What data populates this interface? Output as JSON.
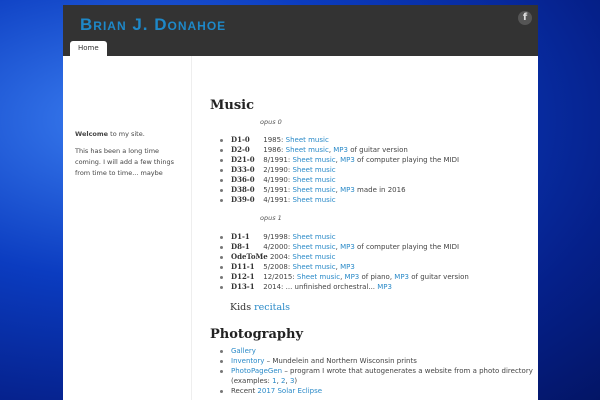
{
  "header": {
    "title": "Brian J. Donahoe",
    "facebook_icon": "facebook-icon",
    "nav": [
      {
        "label": "Home"
      }
    ]
  },
  "sidebar": {
    "welcome_bold": "Welcome",
    "welcome_rest": " to my site.",
    "note": "This has been a long time coming. I will add a few things from time to time... maybe"
  },
  "music": {
    "title": "Music",
    "opus0": {
      "label": "opus 0",
      "items": [
        {
          "code": "D1-0",
          "parts": [
            {
              "t": "1985: "
            },
            {
              "t": "Sheet music",
              "link": true
            }
          ]
        },
        {
          "code": "D2-0",
          "parts": [
            {
              "t": "1986: "
            },
            {
              "t": "Sheet music",
              "link": true
            },
            {
              "t": ", "
            },
            {
              "t": "MP3",
              "link": true
            },
            {
              "t": " of guitar version"
            }
          ]
        },
        {
          "code": "D21-0",
          "parts": [
            {
              "t": "8/1991: "
            },
            {
              "t": "Sheet music",
              "link": true
            },
            {
              "t": ", "
            },
            {
              "t": "MP3",
              "link": true
            },
            {
              "t": " of computer playing the MIDI"
            }
          ]
        },
        {
          "code": "D33-0",
          "parts": [
            {
              "t": "2/1990: "
            },
            {
              "t": "Sheet music",
              "link": true
            }
          ]
        },
        {
          "code": "D36-0",
          "parts": [
            {
              "t": "4/1990: "
            },
            {
              "t": "Sheet music",
              "link": true
            }
          ]
        },
        {
          "code": "D38-0",
          "parts": [
            {
              "t": "5/1991: "
            },
            {
              "t": "Sheet music",
              "link": true
            },
            {
              "t": ", "
            },
            {
              "t": "MP3",
              "link": true
            },
            {
              "t": " made in 2016"
            }
          ]
        },
        {
          "code": "D39-0",
          "parts": [
            {
              "t": "4/1991: "
            },
            {
              "t": "Sheet music",
              "link": true
            }
          ]
        }
      ]
    },
    "opus1": {
      "label": "opus 1",
      "items": [
        {
          "code": "D1-1",
          "parts": [
            {
              "t": "9/1998: "
            },
            {
              "t": "Sheet music",
              "link": true
            }
          ]
        },
        {
          "code": "D8-1",
          "parts": [
            {
              "t": "4/2000: "
            },
            {
              "t": "Sheet music",
              "link": true
            },
            {
              "t": ", "
            },
            {
              "t": "MP3",
              "link": true
            },
            {
              "t": " of computer playing the MIDI"
            }
          ]
        },
        {
          "code": "OdeToMe",
          "parts": [
            {
              "t": "2004: "
            },
            {
              "t": "Sheet music",
              "link": true
            }
          ]
        },
        {
          "code": "D11-1",
          "parts": [
            {
              "t": "5/2008: "
            },
            {
              "t": "Sheet music",
              "link": true
            },
            {
              "t": ", "
            },
            {
              "t": "MP3",
              "link": true
            }
          ]
        },
        {
          "code": "D12-1",
          "parts": [
            {
              "t": "12/2015: "
            },
            {
              "t": "Sheet music",
              "link": true
            },
            {
              "t": ", "
            },
            {
              "t": "MP3",
              "link": true
            },
            {
              "t": " of piano, "
            },
            {
              "t": "MP3",
              "link": true
            },
            {
              "t": " of guitar version"
            }
          ]
        },
        {
          "code": "D13-1",
          "parts": [
            {
              "t": "2014: ... unfinished orchestral...   "
            },
            {
              "t": "MP3",
              "link": true
            }
          ]
        }
      ]
    },
    "kids_label": "Kids",
    "kids_link": "recitals"
  },
  "photography": {
    "title": "Photography",
    "items": [
      {
        "parts": [
          {
            "t": "Gallery",
            "link": true
          }
        ]
      },
      {
        "parts": [
          {
            "t": "Inventory",
            "link": true
          },
          {
            "t": " – Mundelein and Northern Wisconsin prints"
          }
        ]
      },
      {
        "parts": [
          {
            "t": "PhotoPageGen",
            "link": true
          },
          {
            "t": " – program I wrote that autogenerates a website from a photo directory"
          }
        ]
      },
      {
        "parts": [
          {
            "t": "(examples: "
          },
          {
            "t": "1",
            "link": true
          },
          {
            "t": ", "
          },
          {
            "t": "2",
            "link": true
          },
          {
            "t": ", "
          },
          {
            "t": "3",
            "link": true
          },
          {
            "t": ")"
          }
        ],
        "cont": true
      },
      {
        "parts": [
          {
            "t": "Recent "
          },
          {
            "t": "2017 Solar Eclipse",
            "link": true
          }
        ]
      }
    ]
  }
}
